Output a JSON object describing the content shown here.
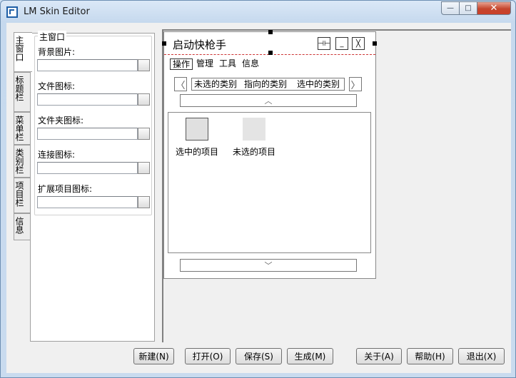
{
  "window": {
    "title": "LM Skin Editor",
    "min_glyph": "—",
    "max_glyph": "□",
    "close_glyph": "✕"
  },
  "tabs": [
    "主窗口",
    "标题栏",
    "菜单栏",
    "类别栏",
    "项目栏",
    "信息"
  ],
  "group": {
    "title": "主窗口",
    "fields": [
      {
        "label": "背景图片:",
        "value": ""
      },
      {
        "label": "文件图标:",
        "value": ""
      },
      {
        "label": "文件夹图标:",
        "value": ""
      },
      {
        "label": "连接图标:",
        "value": ""
      },
      {
        "label": "扩展项目图标:",
        "value": ""
      }
    ]
  },
  "preview": {
    "title": "启动快枪手",
    "btn_pin": "⊣⊢",
    "btn_min": "_",
    "btn_close": "╳",
    "menus": [
      "操作",
      "管理",
      "工具",
      "信息"
    ],
    "categories": [
      "未选的类别",
      "指向的类别",
      "选中的类别"
    ],
    "left_arrow": "〈",
    "right_arrow": "〉",
    "up_arrow": "︿",
    "down_arrow": "﹀",
    "items": [
      {
        "label": "选中的项目"
      },
      {
        "label": "未选的项目"
      }
    ]
  },
  "buttons": {
    "new": "新建(N)",
    "open": "打开(O)",
    "save": "保存(S)",
    "generate": "生成(M)",
    "about": "关于(A)",
    "help": "帮助(H)",
    "exit": "退出(X)"
  }
}
